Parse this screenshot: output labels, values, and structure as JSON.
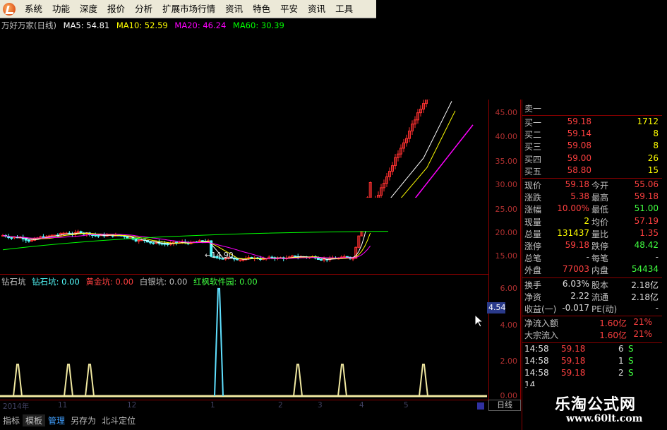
{
  "menu": {
    "items": [
      "系统",
      "功能",
      "深度",
      "报价",
      "分析",
      "扩展市场行情",
      "资讯",
      "特色",
      "平安",
      "资讯",
      "工具"
    ]
  },
  "main_chart": {
    "stock_title": "万好万家(日线)",
    "ma5": "MA5: 54.81",
    "ma10": "MA10: 52.59",
    "ma20": "MA20: 46.24",
    "ma60": "MA60: 30.39",
    "low_marker": "←14.90",
    "price_ticks": [
      "45.00",
      "40.00",
      "35.00",
      "30.00",
      "25.00",
      "20.00",
      "15.00"
    ]
  },
  "sub_chart": {
    "name": "钻石坑",
    "diamond": "钻石坑: 0.00",
    "gold": "黄金坑: 0.00",
    "silver": "白银坑: 0.00",
    "software": "红枫软件园: 0.00",
    "ticks": [
      "6.00",
      "4.00",
      "2.00",
      "0.00"
    ],
    "cursor_value": "4.54"
  },
  "x_axis": {
    "labels": [
      "2014年",
      "11",
      "12",
      "1",
      "2",
      "3",
      "4",
      "5"
    ],
    "period": "日线"
  },
  "tabs": [
    "指标",
    "模板",
    "管理",
    "另存为",
    "北斗定位"
  ],
  "quote_panel": {
    "sell1_header": "卖一",
    "buy_rows": [
      {
        "label": "买一",
        "price": "59.18",
        "vol": "1712"
      },
      {
        "label": "买二",
        "price": "59.14",
        "vol": "8"
      },
      {
        "label": "买三",
        "price": "59.08",
        "vol": "8"
      },
      {
        "label": "买四",
        "price": "59.00",
        "vol": "26"
      },
      {
        "label": "买五",
        "price": "58.80",
        "vol": "15"
      }
    ],
    "stats": [
      {
        "l1": "现价",
        "v1": "59.18",
        "l2": "今开",
        "v2": "55.06"
      },
      {
        "l1": "涨跌",
        "v1": "5.38",
        "l2": "最高",
        "v2": "59.18"
      },
      {
        "l1": "涨幅",
        "v1": "10.00%",
        "l2": "最低",
        "v2": "51.00"
      },
      {
        "l1": "现量",
        "v1": "2",
        "l2": "均价",
        "v2": "57.19"
      },
      {
        "l1": "总量",
        "v1": "131437",
        "l2": "量比",
        "v2": "1.35"
      },
      {
        "l1": "涨停",
        "v1": "59.18",
        "l2": "跌停",
        "v2": "48.42"
      },
      {
        "l1": "总笔",
        "v1": "-",
        "l2": "每笔",
        "v2": "-"
      },
      {
        "l1": "外盘",
        "v1": "77003",
        "l2": "内盘",
        "v2": "54434"
      }
    ],
    "fund": [
      {
        "l1": "换手",
        "v1": "6.03%",
        "l2": "股本",
        "v2": "2.18亿"
      },
      {
        "l1": "净资",
        "v1": "2.22",
        "l2": "流通",
        "v2": "2.18亿"
      },
      {
        "l1": "收益(一)",
        "v1": "-0.017",
        "l2": "PE(动)",
        "v2": "-"
      }
    ],
    "flow": [
      {
        "label": "净流入额",
        "value": "1.60亿",
        "pct": "21%"
      },
      {
        "label": "大宗流入",
        "value": "1.60亿",
        "pct": "21%"
      }
    ],
    "ticks": [
      {
        "time": "14:58",
        "price": "59.18",
        "vol": "6",
        "side": "S"
      },
      {
        "time": "14:58",
        "price": "59.18",
        "vol": "1",
        "side": "S"
      },
      {
        "time": "14:58",
        "price": "59.18",
        "vol": "2",
        "side": "S"
      }
    ],
    "tick_partial": "14"
  },
  "watermark": {
    "title": "乐淘公式网",
    "url": "www.60lt.com"
  },
  "colors": {
    "up": "#ff3030",
    "down": "#54ffff",
    "ma5": "#ffffff",
    "ma10": "#ffff00",
    "ma20": "#ff00ff",
    "ma60": "#00ff00",
    "panel_label": "#c0c0c0",
    "panel_red": "#ff4040",
    "panel_green": "#40ff40",
    "panel_yellow": "#ffff00"
  },
  "chart_data": {
    "type": "line",
    "xlabel": "",
    "ylabel": "",
    "x_ticks": [
      "2014年",
      "11",
      "12",
      "1",
      "2",
      "3",
      "4",
      "5"
    ],
    "y_ticks_price": [
      45,
      40,
      35,
      30,
      25,
      20,
      15
    ],
    "y_ticks_indicator": [
      6,
      4,
      2,
      0
    ],
    "series": [
      {
        "name": "钻石坑",
        "values": [
          0,
          0,
          0,
          0,
          0,
          0,
          0
        ]
      },
      {
        "name": "黄金坑",
        "values": [
          0,
          0,
          0,
          0,
          0,
          0,
          0
        ]
      },
      {
        "name": "白银坑",
        "values": [
          0,
          0,
          0,
          0,
          0,
          0,
          0
        ]
      },
      {
        "name": "红枫软件园",
        "values": [
          0,
          0,
          0,
          0,
          0,
          0,
          0
        ]
      }
    ],
    "spikes": [
      2,
      2,
      2,
      6,
      2,
      2,
      2
    ],
    "spike_colors": [
      "#f0e8a0",
      "#f0e8a0",
      "#f0e8a0",
      "#60e0ff",
      "#f0e8a0",
      "#f0e8a0",
      "#f0e8a0"
    ],
    "candles_summary": "price ~20 range then rally to ~50"
  }
}
